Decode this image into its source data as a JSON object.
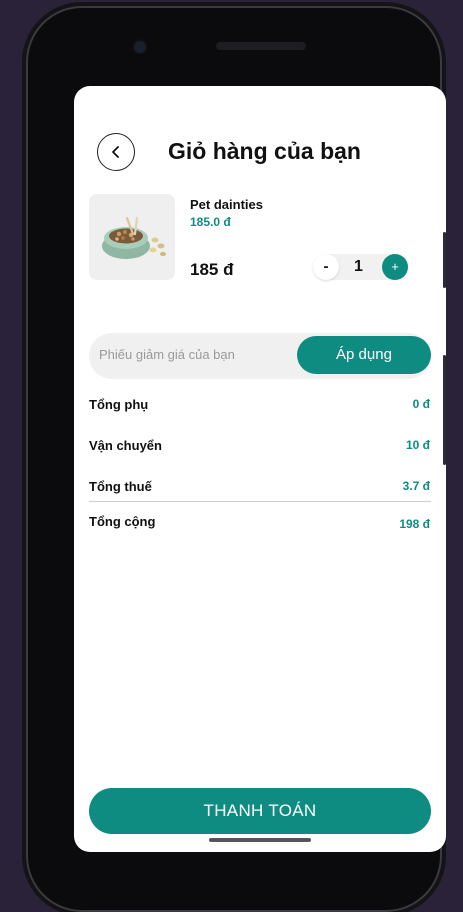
{
  "header": {
    "title": "Giỏ hàng của bạn"
  },
  "cart": {
    "items": [
      {
        "name": "Pet dainties",
        "unit_price": "185.0 đ",
        "line_total": "185 đ",
        "quantity": "1"
      }
    ],
    "qty_minus_label": "-",
    "qty_plus_label": "+"
  },
  "coupon": {
    "placeholder": "Phiếu giảm giá của bạn",
    "value": "",
    "apply_label": "Áp dụng"
  },
  "summary": {
    "subtotal_label": "Tổng phụ",
    "subtotal_value": "0 đ",
    "shipping_label": "Vận chuyển",
    "shipping_value": "10 đ",
    "tax_label": "Tổng thuế",
    "tax_value": "3.7 đ",
    "total_label": "Tổng cộng",
    "total_value": "198 đ"
  },
  "checkout_label": "THANH TOÁN",
  "colors": {
    "accent": "#0e8c82",
    "background": "#2a2238"
  },
  "icons": {
    "back": "chevron-left-icon",
    "product": "pet-food-bowl-image"
  }
}
